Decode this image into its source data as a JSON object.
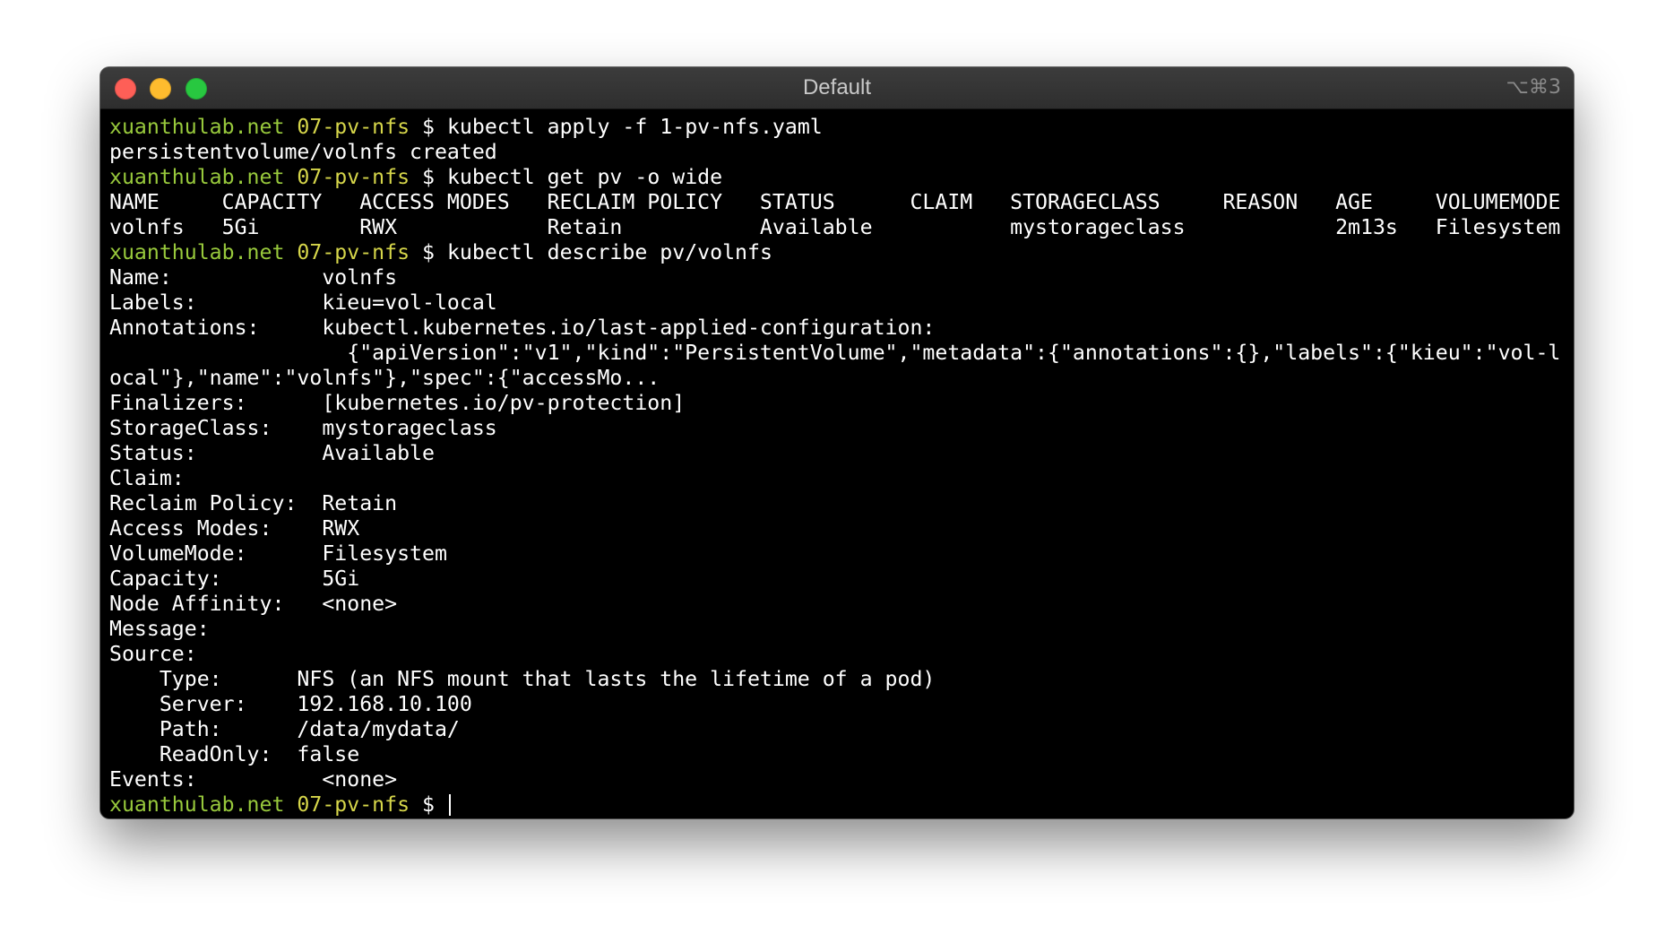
{
  "window": {
    "title": "Default",
    "shortcut": "⌥⌘3",
    "colors": {
      "background": "#000000",
      "hostname": "#98c93c",
      "directory": "#d6d64a",
      "text": "#ffffff"
    }
  },
  "prompt": {
    "host": "xuanthulab.net",
    "dir": "07-pv-nfs",
    "symbol": " $ "
  },
  "commands": {
    "apply": "kubectl apply -f 1-pv-nfs.yaml",
    "get": "kubectl get pv -o wide",
    "describe": "kubectl describe pv/volnfs"
  },
  "output": {
    "apply_result": "persistentvolume/volnfs created",
    "table_header": "NAME     CAPACITY   ACCESS MODES   RECLAIM POLICY   STATUS      CLAIM   STORAGECLASS     REASON   AGE     VOLUMEMODE",
    "table_row": "volnfs   5Gi        RWX            Retain           Available           mystorageclass            2m13s   Filesystem",
    "describe_lines": [
      "Name:            volnfs",
      "Labels:          kieu=vol-local",
      "Annotations:     kubectl.kubernetes.io/last-applied-configuration:",
      "                   {\"apiVersion\":\"v1\",\"kind\":\"PersistentVolume\",\"metadata\":{\"annotations\":{},\"labels\":{\"kieu\":\"vol-l",
      "ocal\"},\"name\":\"volnfs\"},\"spec\":{\"accessMo...",
      "Finalizers:      [kubernetes.io/pv-protection]",
      "StorageClass:    mystorageclass",
      "Status:          Available",
      "Claim:",
      "Reclaim Policy:  Retain",
      "Access Modes:    RWX",
      "VolumeMode:      Filesystem",
      "Capacity:        5Gi",
      "Node Affinity:   <none>",
      "Message:",
      "Source:",
      "    Type:      NFS (an NFS mount that lasts the lifetime of a pod)",
      "    Server:    192.168.10.100",
      "    Path:      /data/mydata/",
      "    ReadOnly:  false",
      "Events:          <none>"
    ]
  }
}
